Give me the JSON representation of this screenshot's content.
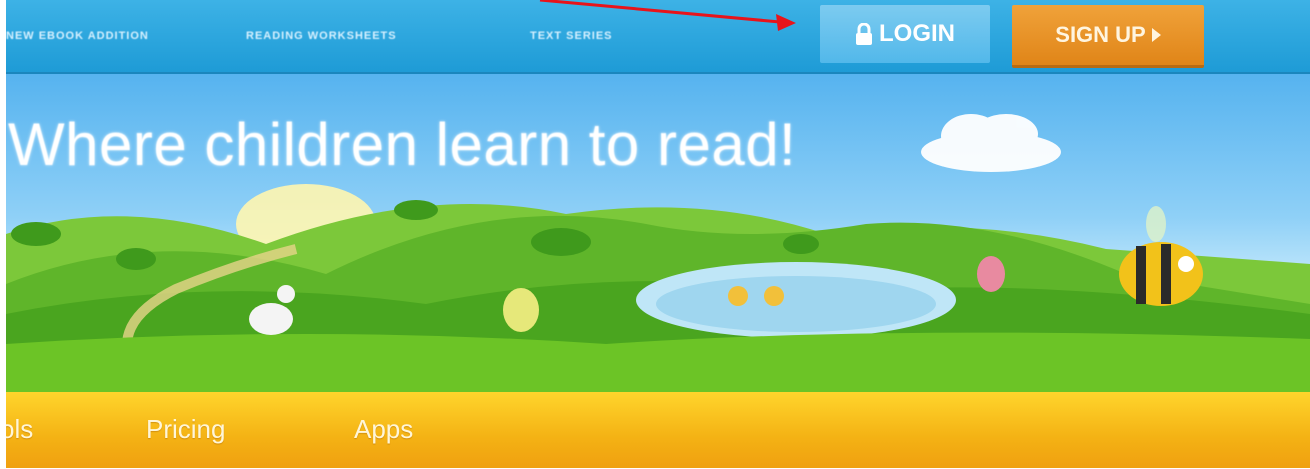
{
  "topbar": {
    "links": [
      "NEW EBOOK ADDITION",
      "READING WORKSHEETS",
      "TEXT SERIES"
    ],
    "login_label": "LOGIN",
    "signup_label": "SIGN UP",
    "login_icon": "lock-icon",
    "signup_icon": "play-triangle-icon"
  },
  "hero": {
    "title": "Where children learn to read!"
  },
  "navbar": {
    "items": [
      "ols",
      "Pricing",
      "Apps"
    ]
  },
  "colors": {
    "topbar": "#1e9bd6",
    "login": "#5ab9ea",
    "signup": "#e08518",
    "navbar": "#f4b214",
    "annotation_arrow": "#e8141b"
  }
}
